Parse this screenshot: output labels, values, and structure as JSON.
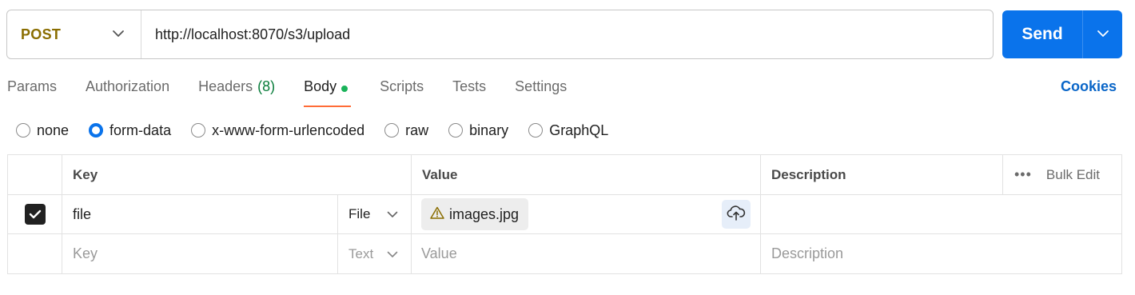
{
  "request": {
    "method": "POST",
    "url": "http://localhost:8070/s3/upload",
    "send_label": "Send"
  },
  "tabs": [
    {
      "label": "Params"
    },
    {
      "label": "Authorization"
    },
    {
      "label": "Headers",
      "count": "(8)"
    },
    {
      "label": "Body",
      "active": true,
      "dot": true
    },
    {
      "label": "Scripts"
    },
    {
      "label": "Tests"
    },
    {
      "label": "Settings"
    }
  ],
  "cookies_label": "Cookies",
  "body_types": [
    {
      "label": "none",
      "selected": false
    },
    {
      "label": "form-data",
      "selected": true
    },
    {
      "label": "x-www-form-urlencoded",
      "selected": false
    },
    {
      "label": "raw",
      "selected": false
    },
    {
      "label": "binary",
      "selected": false
    },
    {
      "label": "GraphQL",
      "selected": false
    }
  ],
  "table": {
    "headers": {
      "key": "Key",
      "value": "Value",
      "description": "Description",
      "bulk_edit": "Bulk Edit",
      "more": "•••"
    },
    "rows": [
      {
        "checked": true,
        "key": "file",
        "type": "File",
        "value_file": "images.jpg",
        "description": ""
      }
    ],
    "new_row": {
      "key_placeholder": "Key",
      "type": "Text",
      "value_placeholder": "Value",
      "description_placeholder": "Description"
    }
  },
  "colors": {
    "accent": "#0a73eb",
    "method": "#8a6d00",
    "tab_underline": "#ff6c37",
    "headers_count": "#097d3b",
    "body_dot": "#1ab35a",
    "cookies": "#0a66c8"
  }
}
